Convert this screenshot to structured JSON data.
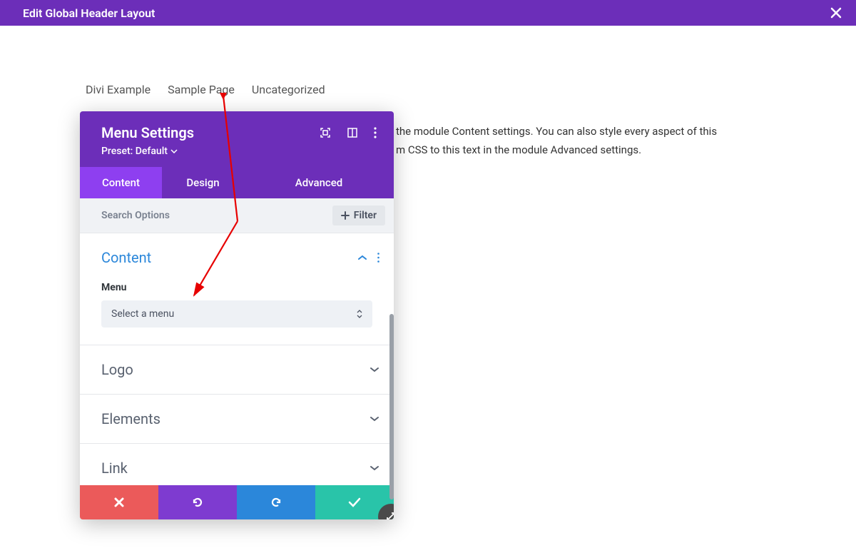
{
  "topbar": {
    "title": "Edit Global Header Layout"
  },
  "nav": {
    "items": [
      "Divi Example",
      "Sample Page",
      "Uncategorized"
    ]
  },
  "bgtext": {
    "line1": "the module Content settings. You can also style every aspect of this",
    "line2": "m CSS to this text in the module Advanced settings."
  },
  "panel": {
    "title": "Menu Settings",
    "preset_label": "Preset: Default",
    "tabs": {
      "content": "Content",
      "design": "Design",
      "advanced": "Advanced"
    },
    "search_placeholder": "Search Options",
    "filter_label": "Filter",
    "sections": {
      "content": {
        "title": "Content",
        "field_label": "Menu",
        "select_value": "Select a menu"
      },
      "logo": {
        "title": "Logo"
      },
      "elements": {
        "title": "Elements"
      },
      "link": {
        "title": "Link"
      }
    }
  }
}
